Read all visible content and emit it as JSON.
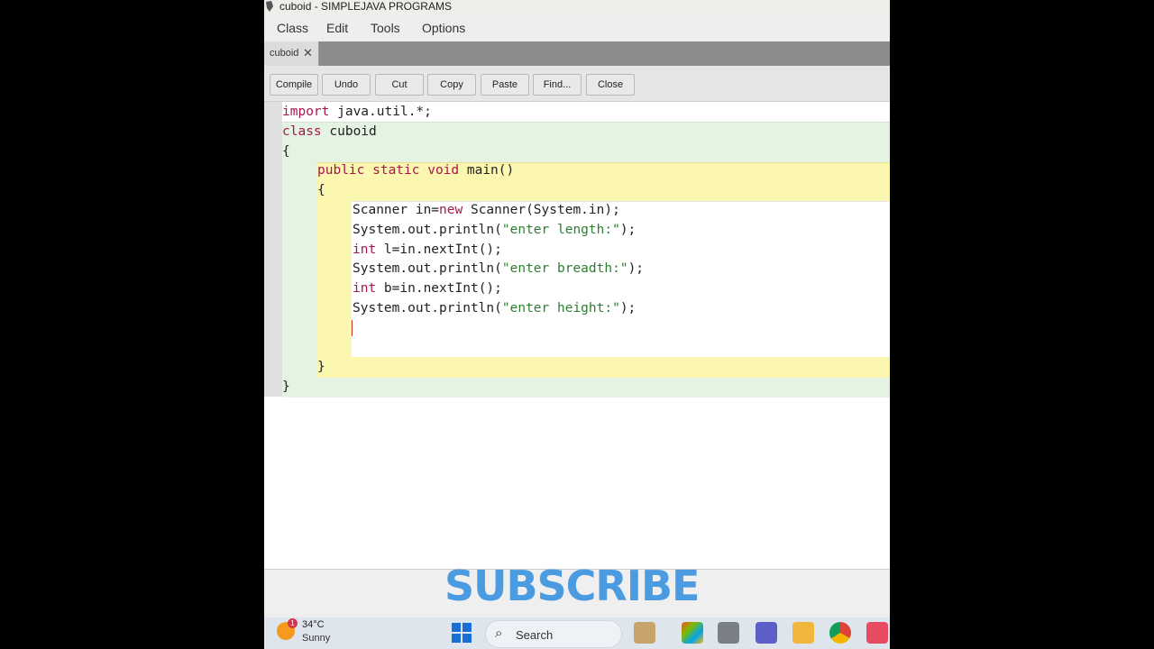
{
  "window": {
    "title": "cuboid - SIMPLEJAVA PROGRAMS"
  },
  "menu": [
    "Class",
    "Edit",
    "Tools",
    "Options"
  ],
  "tab": {
    "label": "cuboid",
    "close_glyph": "✕"
  },
  "toolbar": [
    "Compile",
    "Undo",
    "Cut",
    "Copy",
    "Paste",
    "Find...",
    "Close"
  ],
  "code": {
    "line1": {
      "kw": "import",
      "rest": " java.util.*;"
    },
    "line2": {
      "kw": "class",
      "rest": " cuboid"
    },
    "line3": "{",
    "line4": {
      "kw": "public static void",
      "rest": " main()"
    },
    "line5": "{",
    "line6": {
      "a": "Scanner in=",
      "kw": "new",
      "b": " Scanner(System.in);"
    },
    "line7": {
      "a": "System.out.println(",
      "str": "\"enter length:\"",
      "b": ");"
    },
    "line8": {
      "kw": "int",
      "rest": " l=in.nextInt();"
    },
    "line9": {
      "a": "System.out.println(",
      "str": "\"enter breadth:\"",
      "b": ");"
    },
    "line10": {
      "kw": "int",
      "rest": " b=in.nextInt();"
    },
    "line11": {
      "a": "System.out.println(",
      "str": "\"enter height:\"",
      "b": ");"
    },
    "line13": "}",
    "line14": "}"
  },
  "overlay": {
    "subscribe": "SUBSCRIBE"
  },
  "taskbar": {
    "weather_badge": "1",
    "temperature": "34°C",
    "condition": "Sunny",
    "search_label": "Search",
    "search_glyph": "⌕"
  },
  "colors": {
    "keyword": "#a8164f",
    "string": "#2e7d32",
    "subscribe": "#4a9be0",
    "class_scope": "#e4f3e2",
    "method_scope": "#fbf6b0"
  }
}
